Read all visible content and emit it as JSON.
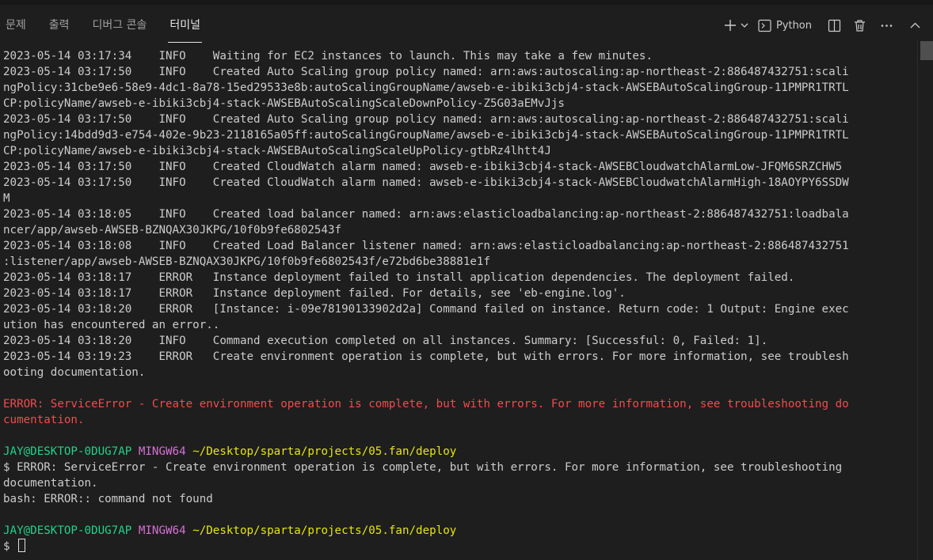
{
  "tabs": [
    {
      "label": "문제"
    },
    {
      "label": "출력"
    },
    {
      "label": "디버그 콘솔"
    },
    {
      "label": "터미널"
    }
  ],
  "actions": {
    "shell_label": "Python",
    "icons": [
      "plus-icon",
      "chevron-down-icon",
      "terminal-icon",
      "split-icon",
      "trash-icon",
      "ellipsis-icon",
      "chevron-up-icon"
    ]
  },
  "colors": {
    "background": "#1e1e1e",
    "error_red": "#f14c4c",
    "prompt_green": "#23d18b",
    "prompt_magenta": "#d670d6",
    "prompt_yellow": "#e5e510"
  },
  "terminal": {
    "log_lines": [
      "2023-05-14 03:17:34    INFO    Waiting for EC2 instances to launch. This may take a few minutes.",
      "2023-05-14 03:17:50    INFO    Created Auto Scaling group policy named: arn:aws:autoscaling:ap-northeast-2:886487432751:scali",
      "ngPolicy:31cbe9e6-58e9-4dc1-8a78-15ed29533e8b:autoScalingGroupName/awseb-e-ibiki3cbj4-stack-AWSEBAutoScalingGroup-11PMPR1TRTL",
      "CP:policyName/awseb-e-ibiki3cbj4-stack-AWSEBAutoScalingScaleDownPolicy-Z5G03aEMvJjs",
      "2023-05-14 03:17:50    INFO    Created Auto Scaling group policy named: arn:aws:autoscaling:ap-northeast-2:886487432751:scali",
      "ngPolicy:14bdd9d3-e754-402e-9b23-2118165a05ff:autoScalingGroupName/awseb-e-ibiki3cbj4-stack-AWSEBAutoScalingGroup-11PMPR1TRTL",
      "CP:policyName/awseb-e-ibiki3cbj4-stack-AWSEBAutoScalingScaleUpPolicy-gtbRz4lhtt4J",
      "2023-05-14 03:17:50    INFO    Created CloudWatch alarm named: awseb-e-ibiki3cbj4-stack-AWSEBCloudwatchAlarmLow-JFQM6SRZCHW5",
      "2023-05-14 03:17:50    INFO    Created CloudWatch alarm named: awseb-e-ibiki3cbj4-stack-AWSEBCloudwatchAlarmHigh-18AOYPY6SSDW",
      "M",
      "2023-05-14 03:18:05    INFO    Created load balancer named: arn:aws:elasticloadbalancing:ap-northeast-2:886487432751:loadbala",
      "ncer/app/awseb-AWSEB-BZNQAX30JKPG/10f0b9fe6802543f",
      "2023-05-14 03:18:08    INFO    Created Load Balancer listener named: arn:aws:elasticloadbalancing:ap-northeast-2:886487432751",
      ":listener/app/awseb-AWSEB-BZNQAX30JKPG/10f0b9fe6802543f/e72bd6be38881e1f",
      "2023-05-14 03:18:17    ERROR   Instance deployment failed to install application dependencies. The deployment failed.",
      "2023-05-14 03:18:17    ERROR   Instance deployment failed. For details, see 'eb-engine.log'.",
      "2023-05-14 03:18:20    ERROR   [Instance: i-09e78190133902d2a] Command failed on instance. Return code: 1 Output: Engine exec",
      "ution has encountered an error..",
      "2023-05-14 03:18:20    INFO    Command execution completed on all instances. Summary: [Successful: 0, Failed: 1].",
      "2023-05-14 03:19:23    ERROR   Create environment operation is complete, but with errors. For more information, see troublesh",
      "ooting documentation."
    ],
    "error_lines": [
      "ERROR: ServiceError - Create environment operation is complete, but with errors. For more information, see troubleshooting do",
      "cumentation."
    ],
    "prompt1": {
      "user": "JAY@DESKTOP-0DUG7AP",
      "env": "MINGW64",
      "path": "~/Desktop/sparta/projects/05.fan/deploy"
    },
    "command_lines": [
      "$ ERROR: ServiceError - Create environment operation is complete, but with errors. For more information, see troubleshooting",
      "documentation.",
      "bash: ERROR:: command not found"
    ],
    "prompt2": {
      "user": "JAY@DESKTOP-0DUG7AP",
      "env": "MINGW64",
      "path": "~/Desktop/sparta/projects/05.fan/deploy"
    },
    "input_prompt": "$"
  }
}
